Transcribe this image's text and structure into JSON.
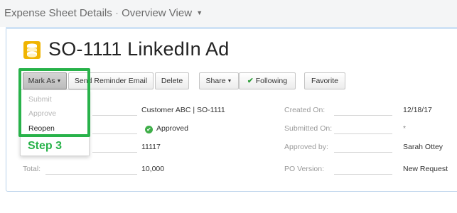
{
  "view": {
    "title": "Expense Sheet Details",
    "separator": "·",
    "view_name": "Overview View"
  },
  "record": {
    "title": "SO-1111 LinkedIn Ad",
    "icon": "coin-stack-icon",
    "icon_color": "#f0b400"
  },
  "toolbar": {
    "mark_as": "Mark As",
    "send_reminder": "Send Reminder Email",
    "delete": "Delete",
    "share": "Share",
    "following": "Following",
    "favorite": "Favorite"
  },
  "mark_as_menu": {
    "items": [
      "Submit",
      "Approve",
      "Reopen"
    ]
  },
  "annotation": {
    "step": "Step 3",
    "color": "#28b24a"
  },
  "fields_left": {
    "project": "Customer ABC | SO-1111",
    "status": "Approved",
    "number": "11117",
    "total_label": "Total:",
    "total": "10,000"
  },
  "fields_right": {
    "created_label": "Created On:",
    "created": "12/18/17",
    "submitted_label": "Submitted On:",
    "submitted": "*",
    "approved_label": "Approved by:",
    "approved": "Sarah Ottey",
    "po_label": "PO Version:",
    "po": "New Request"
  }
}
